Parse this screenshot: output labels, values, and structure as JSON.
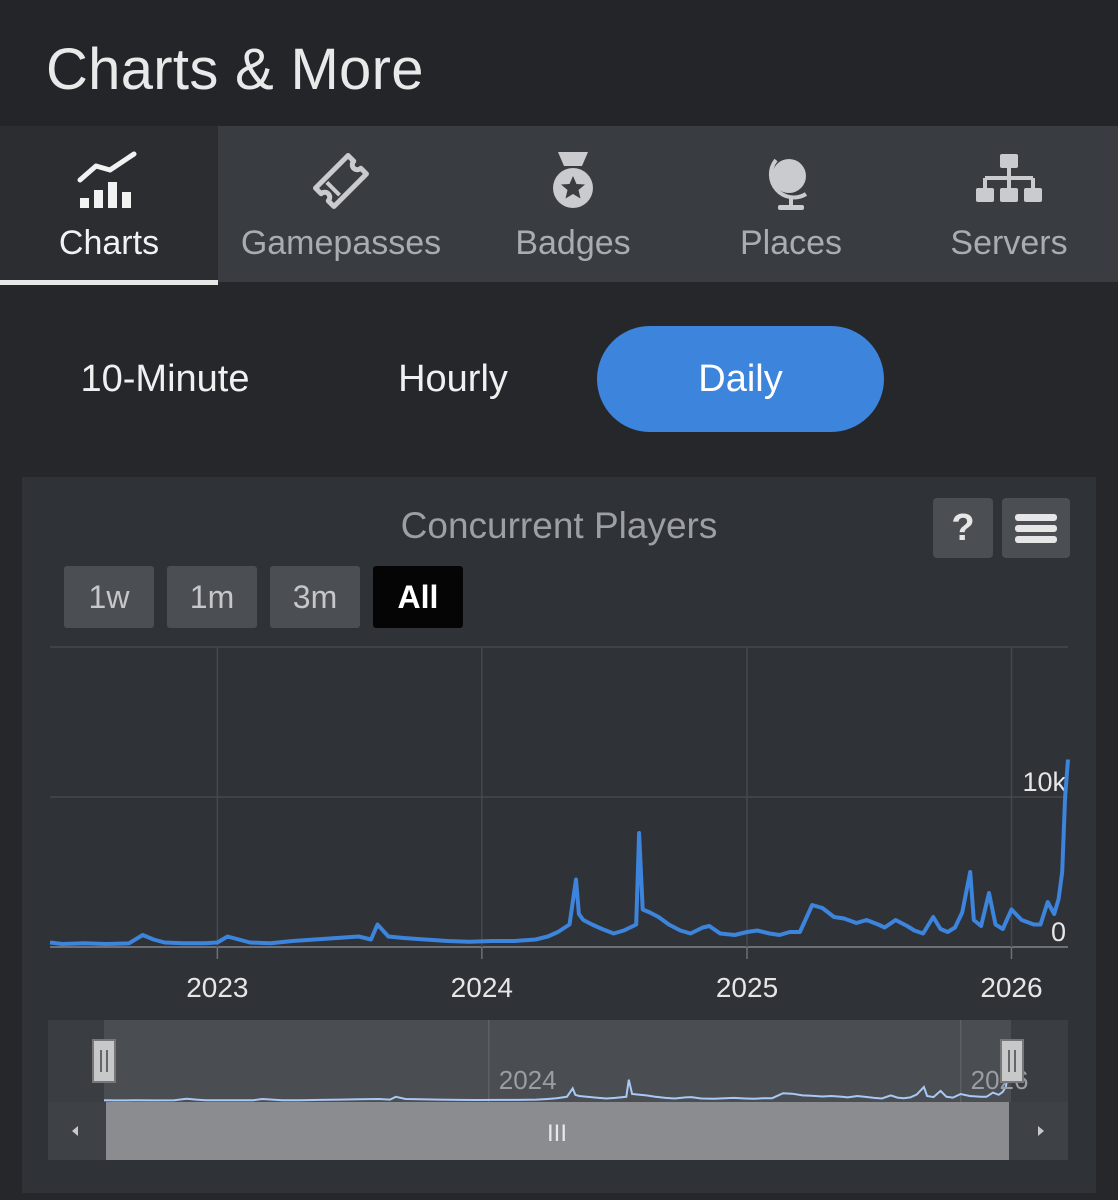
{
  "header": {
    "title": "Charts & More"
  },
  "tabs": [
    {
      "label": "Charts",
      "icon": "chart-icon",
      "active": true
    },
    {
      "label": "Gamepasses",
      "icon": "ticket-icon",
      "active": false
    },
    {
      "label": "Badges",
      "icon": "badge-medal-icon",
      "active": false
    },
    {
      "label": "Places",
      "icon": "globe-icon",
      "active": false
    },
    {
      "label": "Servers",
      "icon": "server-network-icon",
      "active": false
    }
  ],
  "modes": [
    {
      "label": "10-Minute",
      "active": false
    },
    {
      "label": "Hourly",
      "active": false
    },
    {
      "label": "Daily",
      "active": true
    }
  ],
  "chart": {
    "help_label": "?",
    "menu_icon": "hamburger-menu-icon",
    "ranges": [
      {
        "label": "1w",
        "active": false
      },
      {
        "label": "1m",
        "active": false
      },
      {
        "label": "3m",
        "active": false
      },
      {
        "label": "All",
        "active": true
      }
    ],
    "navigator": {
      "labels": [
        "2024",
        "2026"
      ],
      "handle_glyph": "III"
    }
  },
  "colors": {
    "accent": "#3c84dc",
    "line": "#3c84dc",
    "navigator_line": "#a9c9f5",
    "background": "#25272a",
    "tab_bar": "#393c41"
  },
  "chart_data": {
    "type": "line",
    "title": "Concurrent Players",
    "x_tick_labels": [
      "2023",
      "2024",
      "2025",
      "2026"
    ],
    "y_tick_labels": [
      "0",
      "10k"
    ],
    "ylim": [
      0,
      20000
    ],
    "grid": true,
    "series": [
      {
        "x": [
          "2022-05-15",
          "2022-06-01",
          "2022-07-01",
          "2022-08-01",
          "2022-09-01",
          "2022-09-20",
          "2022-10-05",
          "2022-10-20",
          "2022-11-15",
          "2022-12-15",
          "2023-01-01",
          "2023-01-15",
          "2023-02-15",
          "2023-03-15",
          "2023-04-15",
          "2023-05-15",
          "2023-06-15",
          "2023-07-15",
          "2023-08-01",
          "2023-08-10",
          "2023-08-25",
          "2023-09-15",
          "2023-10-15",
          "2023-11-15",
          "2023-12-15",
          "2024-01-15",
          "2024-02-15",
          "2024-03-15",
          "2024-04-01",
          "2024-04-15",
          "2024-05-01",
          "2024-05-10",
          "2024-05-14",
          "2024-05-20",
          "2024-06-01",
          "2024-06-15",
          "2024-07-01",
          "2024-07-15",
          "2024-08-01",
          "2024-08-05",
          "2024-08-10",
          "2024-08-20",
          "2024-09-01",
          "2024-09-15",
          "2024-10-01",
          "2024-10-15",
          "2024-11-01",
          "2024-11-10",
          "2024-11-25",
          "2024-12-15",
          "2025-01-01",
          "2025-01-15",
          "2025-02-01",
          "2025-02-15",
          "2025-03-01",
          "2025-03-15",
          "2025-04-01",
          "2025-04-15",
          "2025-05-01",
          "2025-05-15",
          "2025-06-01",
          "2025-06-15",
          "2025-07-01",
          "2025-07-10",
          "2025-07-25",
          "2025-08-10",
          "2025-08-20",
          "2025-09-01",
          "2025-09-15",
          "2025-09-25",
          "2025-10-05",
          "2025-10-15",
          "2025-10-25",
          "2025-11-05",
          "2025-11-10",
          "2025-11-20",
          "2025-12-01",
          "2025-12-10",
          "2025-12-20",
          "2026-01-01",
          "2026-01-15",
          "2026-02-01",
          "2026-02-10",
          "2026-02-20",
          "2026-03-01",
          "2026-03-07",
          "2026-03-12",
          "2026-03-16",
          "2026-03-20"
        ],
        "y": [
          300,
          200,
          250,
          200,
          250,
          800,
          500,
          300,
          250,
          250,
          300,
          700,
          300,
          250,
          400,
          500,
          600,
          700,
          500,
          1500,
          700,
          600,
          500,
          400,
          350,
          400,
          400,
          500,
          700,
          1000,
          1500,
          4500,
          2200,
          1800,
          1500,
          1200,
          900,
          1100,
          1500,
          7600,
          2500,
          2300,
          2000,
          1500,
          1100,
          900,
          1300,
          1400,
          900,
          800,
          1000,
          1100,
          900,
          800,
          1000,
          1000,
          2800,
          2600,
          2000,
          1900,
          1600,
          1800,
          1500,
          1300,
          1800,
          1400,
          1100,
          900,
          2000,
          1200,
          1000,
          1300,
          2300,
          5000,
          1800,
          1400,
          3600,
          1500,
          1200,
          2500,
          1800,
          1500,
          1500,
          3000,
          2200,
          3200,
          5000,
          10000,
          12500
        ]
      }
    ]
  }
}
